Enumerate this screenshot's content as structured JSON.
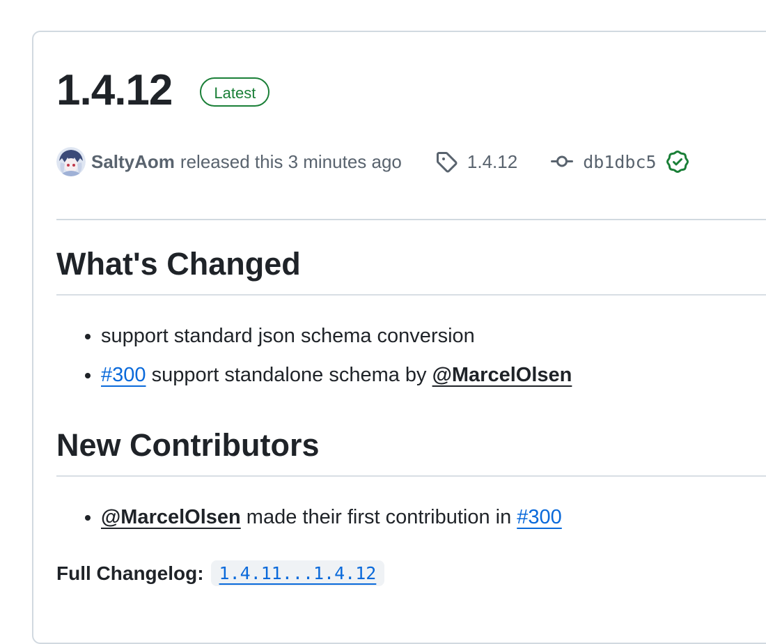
{
  "release": {
    "title": "1.4.12",
    "badge": "Latest",
    "author": "SaltyAom",
    "released_text": "released this 3 minutes ago",
    "tag": "1.4.12",
    "commit": "db1dbc5"
  },
  "whats_changed": {
    "heading": "What's Changed",
    "item1": "support standard json schema conversion",
    "item2_link": "#300",
    "item2_text": " support standalone schema by ",
    "item2_mention": "@MarcelOlsen"
  },
  "new_contributors": {
    "heading": "New Contributors",
    "mention": "@MarcelOlsen",
    "text": " made their first contribution in ",
    "link": "#300"
  },
  "full_changelog": {
    "label": "Full Changelog",
    "colon": ":",
    "compare": "1.4.11...1.4.12"
  },
  "colors": {
    "latest_green": "#1a7f37",
    "link_blue": "#0969da",
    "text": "#1f2328",
    "muted": "#59636e",
    "border": "#d1d9e0"
  },
  "icons": {
    "tag": "tag-icon",
    "commit": "git-commit-icon",
    "verified": "verified-check-icon"
  }
}
